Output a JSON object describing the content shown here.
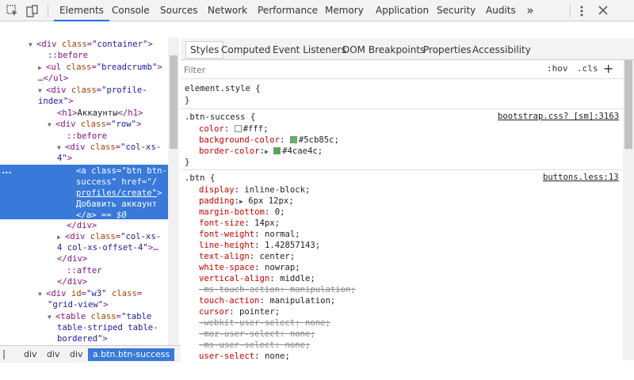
{
  "toolbar": {
    "inspect_icon": "inspect-cursor-icon",
    "device_icon": "device-toggle-icon",
    "tabs": [
      {
        "label": "Elements"
      },
      {
        "label": "Console"
      },
      {
        "label": "Sources"
      },
      {
        "label": "Network"
      },
      {
        "label": "Performance"
      },
      {
        "label": "Memory"
      },
      {
        "label": "Application"
      },
      {
        "label": "Security"
      },
      {
        "label": "Audits"
      }
    ],
    "more": "»",
    "accent": "#1a73e8"
  },
  "dom": {
    "lines": [
      {
        "a": "▼",
        "t1": "<div ",
        "an": "class",
        "av": "\"container\"",
        "t2": ">"
      },
      {
        "pseudo": "::before"
      },
      {
        "a": "▶",
        "t1": "<ul ",
        "an": "class",
        "av": "\"breadcrumb\"",
        "t2": ">"
      },
      {
        "text": "…</ul>"
      },
      {
        "a": "▼",
        "t1": "<div ",
        "an": "class",
        "av": "\"profile-",
        "t2": ""
      },
      {
        "av": "index\"",
        "t2": ">"
      },
      {
        "t1": "<h1>",
        "text": "Аккаунты",
        "t2": "</h1>"
      },
      {
        "a": "▼",
        "t1": "<div ",
        "an": "class",
        "av": "\"row\"",
        "t2": ">"
      },
      {
        "pseudo": "::before"
      },
      {
        "a": "▼",
        "t1": "<div ",
        "an": "class",
        "av": "\"col-xs-",
        "t2": ""
      },
      {
        "av": "4\"",
        "t2": ">"
      }
    ],
    "selected": [
      {
        "t1": "<a ",
        "an": "class",
        "av": "\"btn btn-"
      },
      {
        "av": "success\"",
        "an2": " href",
        "av2": "=\"/"
      },
      {
        "av": "profiles/create\"",
        "t2": ">"
      },
      {
        "text": "Добавить аккаунт"
      },
      {
        "t1": "</a>",
        "text": " == $0"
      }
    ],
    "selected_marker": "...",
    "after_lines": [
      {
        "t1": "</div>"
      },
      {
        "a": "▶",
        "t1": "<div ",
        "an": "class",
        "av": "\"col-xs-"
      },
      {
        "av": "4 col-xs-offset-4\"",
        "t2": ">…"
      },
      {
        "t1": "</div>"
      },
      {
        "pseudo": "::after"
      },
      {
        "t1": "</div>"
      },
      {
        "a": "▼",
        "t1": "<div ",
        "an": "id",
        "av": "\"w3\"",
        "an2": " class",
        "av2": "="
      },
      {
        "av": "\"grid-view\"",
        "t2": ">"
      },
      {
        "a": "▼",
        "t1": "<table ",
        "an": "class",
        "av": "\"table"
      },
      {
        "av": "table-striped table-"
      },
      {
        "av": "bordered\"",
        "t2": ">"
      }
    ]
  },
  "breadcrumb": {
    "items": [
      {
        "label": "div"
      },
      {
        "label": "div"
      },
      {
        "label": "div"
      },
      {
        "label": "a.btn.btn-success"
      }
    ]
  },
  "styles": {
    "subtabs": [
      {
        "label": "Styles"
      },
      {
        "label": "Computed"
      },
      {
        "label": "Event Listeners"
      },
      {
        "label": "DOM Breakpoints"
      },
      {
        "label": "Properties"
      },
      {
        "label": "Accessibility"
      }
    ],
    "filter_placeholder": "Filter",
    "hov": ":hov",
    "cls": ".cls",
    "plus": "+",
    "element_style": {
      "selector": "element.style {",
      "close": "}"
    },
    "btn_success": {
      "selector": ".btn-success {",
      "source": "bootstrap.css? [sm]:3163",
      "props": [
        {
          "name": "color",
          "value": "#fff;",
          "swatch": "#ffffff"
        },
        {
          "name": "background-color",
          "value": "#5cb85c;",
          "swatch": "#5cb85c"
        },
        {
          "name": "border-color",
          "value": "#4cae4c;",
          "swatch": "#4cae4c",
          "expand": "▶"
        }
      ],
      "close": "}"
    },
    "btn": {
      "selector": ".btn {",
      "source": "buttons.less:13",
      "props": [
        {
          "name": "display",
          "value": "inline-block;"
        },
        {
          "name": "padding",
          "value": "6px 12px;",
          "expand": "▶"
        },
        {
          "name": "margin-bottom",
          "value": "0;"
        },
        {
          "name": "font-size",
          "value": "14px;"
        },
        {
          "name": "font-weight",
          "value": "normal;"
        },
        {
          "name": "line-height",
          "value": "1.42857143;"
        },
        {
          "name": "text-align",
          "value": "center;"
        },
        {
          "name": "white-space",
          "value": "nowrap;"
        },
        {
          "name": "vertical-align",
          "value": "middle;"
        },
        {
          "name": "-ms-touch-action",
          "value": "manipulation;",
          "struck": true
        },
        {
          "name": "touch-action",
          "value": "manipulation;"
        },
        {
          "name": "cursor",
          "value": "pointer;"
        },
        {
          "name": "-webkit-user-select",
          "value": "none;",
          "struck": true
        },
        {
          "name": "-moz-user-select",
          "value": "none;",
          "struck": true
        },
        {
          "name": "-ms-user-select",
          "value": "none;",
          "struck": true
        },
        {
          "name": "user-select",
          "value": "none;"
        }
      ]
    }
  }
}
